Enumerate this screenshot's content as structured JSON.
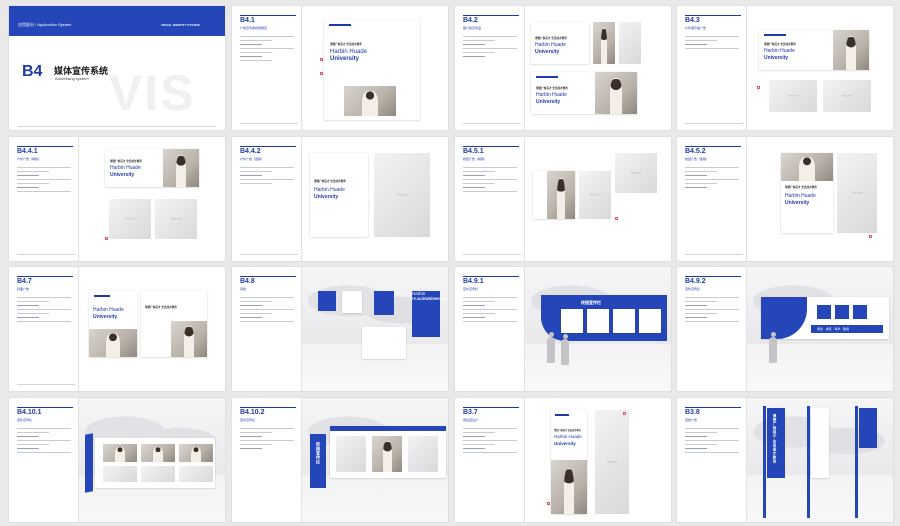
{
  "cover": {
    "section": "应用部分 / Application System",
    "brand": "VISUAL IDENTITY SYSTEM",
    "code": "B4",
    "title": "媒体宣传系统",
    "subtitle": "Advertising system",
    "watermark": "VIS"
  },
  "common": {
    "slogan": "博德广纳英才 全员成才教育",
    "uni_line1": "Harbin Huade",
    "uni_line2": "University",
    "text_area": "Text Area",
    "regional": "Regional"
  },
  "pages": [
    {
      "code": "B4.1",
      "title": "广告宣传类视觉规范"
    },
    {
      "code": "B4.2",
      "title": "路灯旗宣传品"
    },
    {
      "code": "B4.3",
      "title": "户外展示板广告"
    },
    {
      "code": "B4.4.1",
      "title": "户外广告（横版）"
    },
    {
      "code": "B4.4.2",
      "title": "户外广告（竖版）"
    },
    {
      "code": "B4.5.1",
      "title": "校园广告（横版）"
    },
    {
      "code": "B4.5.2",
      "title": "校园广告（竖版）"
    },
    {
      "code": "B4.7",
      "title": "封面广告"
    },
    {
      "code": "B4.8",
      "title": "吊旗"
    },
    {
      "code": "B4.9.1",
      "title": "室外宣传栏"
    },
    {
      "code": "B4.9.2",
      "title": "室外宣传栏"
    },
    {
      "code": "B4.10.1",
      "title": "室外宣传栏"
    },
    {
      "code": "B4.10.2",
      "title": "室外宣传栏"
    },
    {
      "code": "B3.7",
      "title": "易拉宝设计"
    },
    {
      "code": "B3.8",
      "title": "道旗广告"
    }
  ],
  "signage": {
    "board_title": "校园宣传栏",
    "vertical_board": "校园宣传栏",
    "banner_text": "博德 · 求真 · 笃学 · 致用",
    "flag_text": "博德广纳英才 全员成才教育"
  },
  "colors": {
    "brand_blue": "#2546b8",
    "accent_red": "#e0566f"
  }
}
